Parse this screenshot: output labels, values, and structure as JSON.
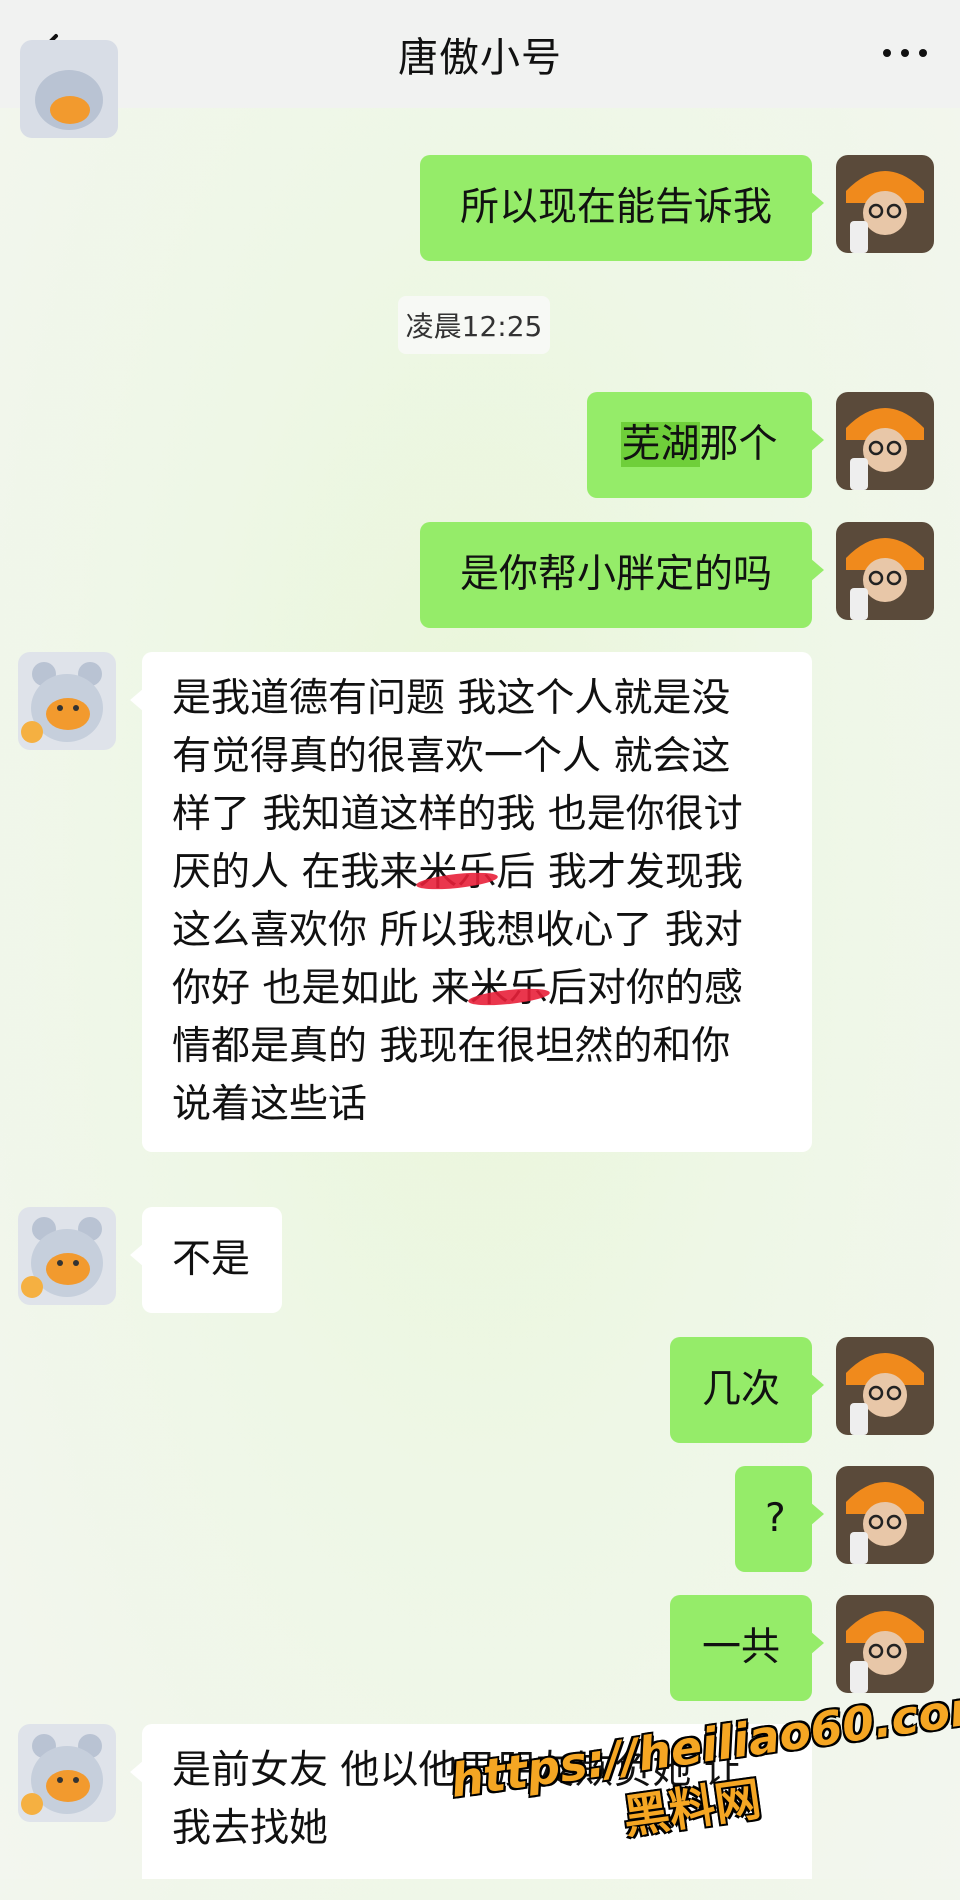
{
  "header": {
    "title": "唐傲小号",
    "back_icon": "chevron-left-icon",
    "more_icon": "more-dots-icon"
  },
  "timestamp": "凌晨12:25",
  "messages": [
    {
      "side": "me",
      "text": "所以现在能告诉我"
    },
    {
      "side": "me",
      "highlight": "芜湖",
      "text": "那个"
    },
    {
      "side": "me",
      "text": "是你帮小胖定的吗"
    },
    {
      "side": "other",
      "lines": [
        "是我道德有问题 我这个人就是没",
        "有觉得真的很喜欢一个人 就会这",
        "样了 我知道这样的我 也是你很讨",
        {
          "a": "厌的人  在我来",
          "r": "米乐",
          "b": "后 我才发现我"
        },
        "这么喜欢你 所以我想收心了 我对",
        {
          "a": "你好 也是如此 来",
          "r": "米乐",
          "b": "后对你的感"
        },
        "情都是真的 我现在很坦然的和你",
        "说着这些话"
      ]
    },
    {
      "side": "other",
      "text": "不是"
    },
    {
      "side": "me",
      "text": "几次"
    },
    {
      "side": "me",
      "text": "?"
    },
    {
      "side": "me",
      "text": "一共"
    },
    {
      "side": "other",
      "lines": [
        "是前女友 他以他男朋友欺负她 让",
        "我去找她"
      ]
    }
  ],
  "watermark": {
    "url": "https://heiliao60.com",
    "name": "黑料网"
  },
  "colors": {
    "me_bubble": "#95ec69",
    "other_bubble": "#ffffff",
    "redaction": "#e8203a",
    "watermark": "#f5a623"
  }
}
